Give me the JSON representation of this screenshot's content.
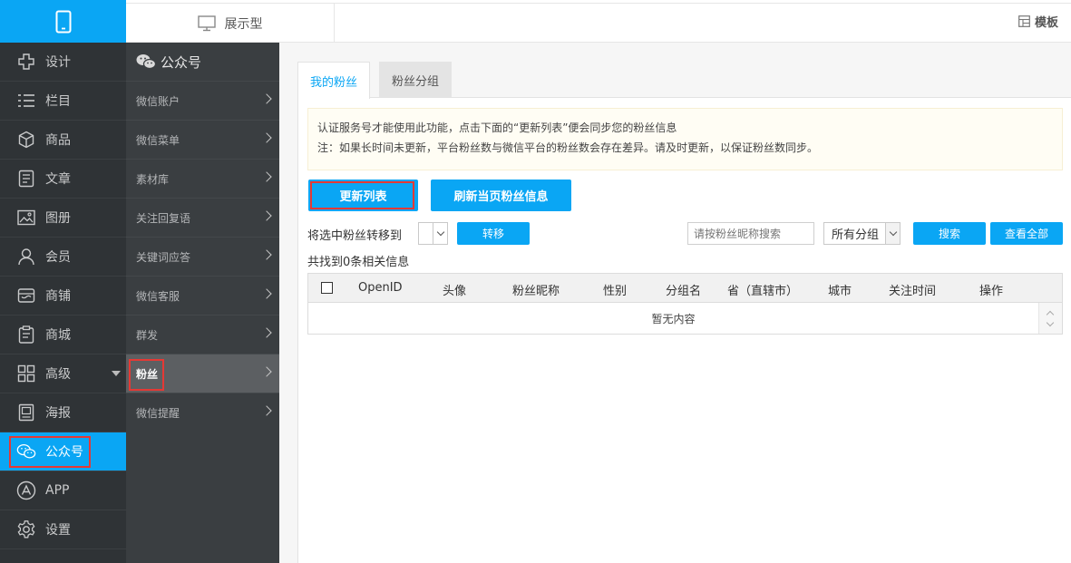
{
  "header": {
    "display_type_label": "展示型",
    "template_label": "模板"
  },
  "sidebar": {
    "items": [
      {
        "label": "设计",
        "icon": "design-icon"
      },
      {
        "label": "栏目",
        "icon": "list-icon"
      },
      {
        "label": "商品",
        "icon": "box-icon"
      },
      {
        "label": "文章",
        "icon": "article-icon"
      },
      {
        "label": "图册",
        "icon": "image-icon"
      },
      {
        "label": "会员",
        "icon": "user-icon"
      },
      {
        "label": "商铺",
        "icon": "shop-icon"
      },
      {
        "label": "商城",
        "icon": "clipboard-icon"
      },
      {
        "label": "高级",
        "icon": "grid-icon"
      },
      {
        "label": "海报",
        "icon": "poster-icon"
      },
      {
        "label": "公众号",
        "icon": "wechat-icon",
        "active": true
      },
      {
        "label": "APP",
        "icon": "app-icon"
      },
      {
        "label": "设置",
        "icon": "gear-icon"
      }
    ]
  },
  "submenu": {
    "title": "公众号",
    "items": [
      {
        "label": "微信账户"
      },
      {
        "label": "微信菜单"
      },
      {
        "label": "素材库"
      },
      {
        "label": "关注回复语"
      },
      {
        "label": "关键词应答"
      },
      {
        "label": "微信客服"
      },
      {
        "label": "群发"
      },
      {
        "label": "粉丝",
        "active": true
      },
      {
        "label": "微信提醒"
      }
    ]
  },
  "main": {
    "tabs": [
      {
        "label": "我的粉丝",
        "active": true
      },
      {
        "label": "粉丝分组"
      }
    ],
    "notice": {
      "line1": "认证服务号才能使用此功能，点击下面的“更新列表”便会同步您的粉丝信息",
      "line2": "注：如果长时间未更新，平台粉丝数与微信平台的粉丝数会存在差异。请及时更新，以保证粉丝数同步。"
    },
    "buttons": {
      "update_list": "更新列表",
      "refresh_page": "刷新当页粉丝信息",
      "move": "转移",
      "search": "搜索",
      "view_all": "查看全部"
    },
    "move_label": "将选中粉丝转移到",
    "search_placeholder": "请按粉丝昵称搜索",
    "group_select_value": "所有分组",
    "result_text": "共找到0条相关信息",
    "table": {
      "columns": [
        "OpenID",
        "头像",
        "粉丝昵称",
        "性别",
        "分组名",
        "省（直辖市）",
        "城市",
        "关注时间",
        "操作"
      ],
      "empty_text": "暂无内容"
    }
  }
}
